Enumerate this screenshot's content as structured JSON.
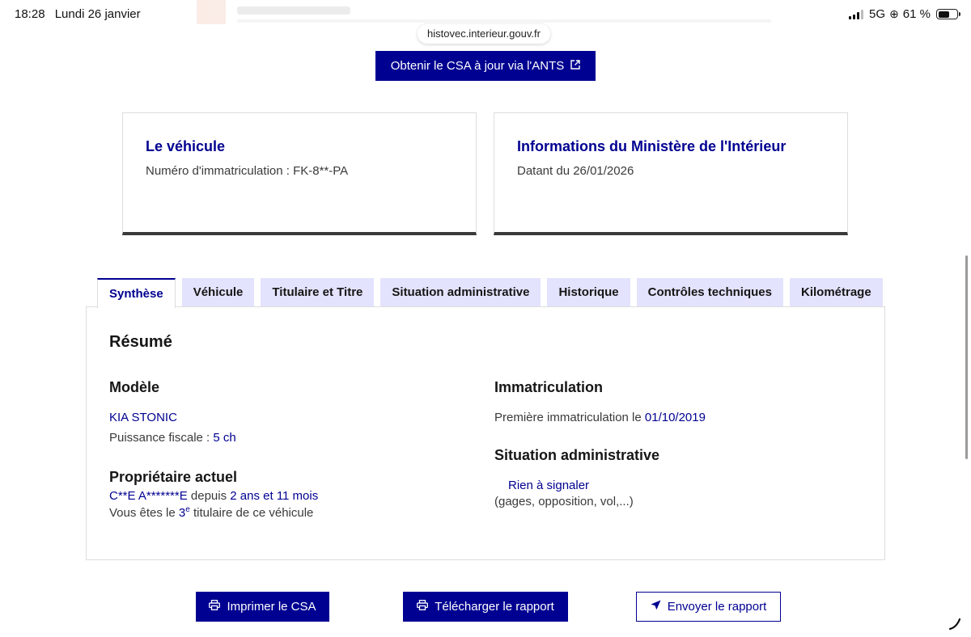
{
  "status_bar": {
    "time": "18:28",
    "date": "Lundi 26 janvier",
    "network": "5G",
    "battery": "61 %",
    "battery_level": 0.61
  },
  "browser": {
    "url": "histovec.interieur.gouv.fr"
  },
  "csa_button": {
    "label": "Obtenir le CSA à jour via l'ANTS",
    "icon": "external-link-icon"
  },
  "cards": {
    "vehicle": {
      "title": "Le véhicule",
      "text": "Numéro d'immatriculation : FK-8**-PA"
    },
    "ministry": {
      "title": "Informations du Ministère de l'Intérieur",
      "text": "Datant du 26/01/2026"
    }
  },
  "tabs": [
    {
      "label": "Synthèse",
      "active": true
    },
    {
      "label": "Véhicule",
      "active": false
    },
    {
      "label": "Titulaire et Titre",
      "active": false
    },
    {
      "label": "Situation administrative",
      "active": false
    },
    {
      "label": "Historique",
      "active": false
    },
    {
      "label": "Contrôles techniques",
      "active": false
    },
    {
      "label": "Kilométrage",
      "active": false
    }
  ],
  "summary": {
    "heading": "Résumé",
    "model": {
      "title": "Modèle",
      "name": "KIA STONIC",
      "fiscal_label": "Puissance fiscale : ",
      "fiscal_value": "5 ch"
    },
    "owner": {
      "title": "Propriétaire actuel",
      "name": "C**E A*******E",
      "since_label": " depuis ",
      "since_value": "2 ans et 11 mois",
      "rank_prefix": "Vous êtes le ",
      "rank_number": "3",
      "rank_suffix": "e",
      "rank_tail": " titulaire de ce véhicule"
    },
    "registration": {
      "title": "Immatriculation",
      "label": "Première immatriculation le ",
      "date": "01/10/2019"
    },
    "admin": {
      "title": "Situation administrative",
      "status": "Rien à signaler",
      "note": "(gages, opposition, vol,...)"
    }
  },
  "actions": {
    "print": {
      "label": "Imprimer le CSA",
      "icon": "printer-icon"
    },
    "download": {
      "label": "Télécharger le rapport",
      "icon": "printer-icon"
    },
    "send": {
      "label": "Envoyer le rapport",
      "icon": "send-icon"
    }
  },
  "colors": {
    "primary": "#000091",
    "tab_bg": "#e3e3fd",
    "card_border_bottom": "#3a3a3a"
  }
}
